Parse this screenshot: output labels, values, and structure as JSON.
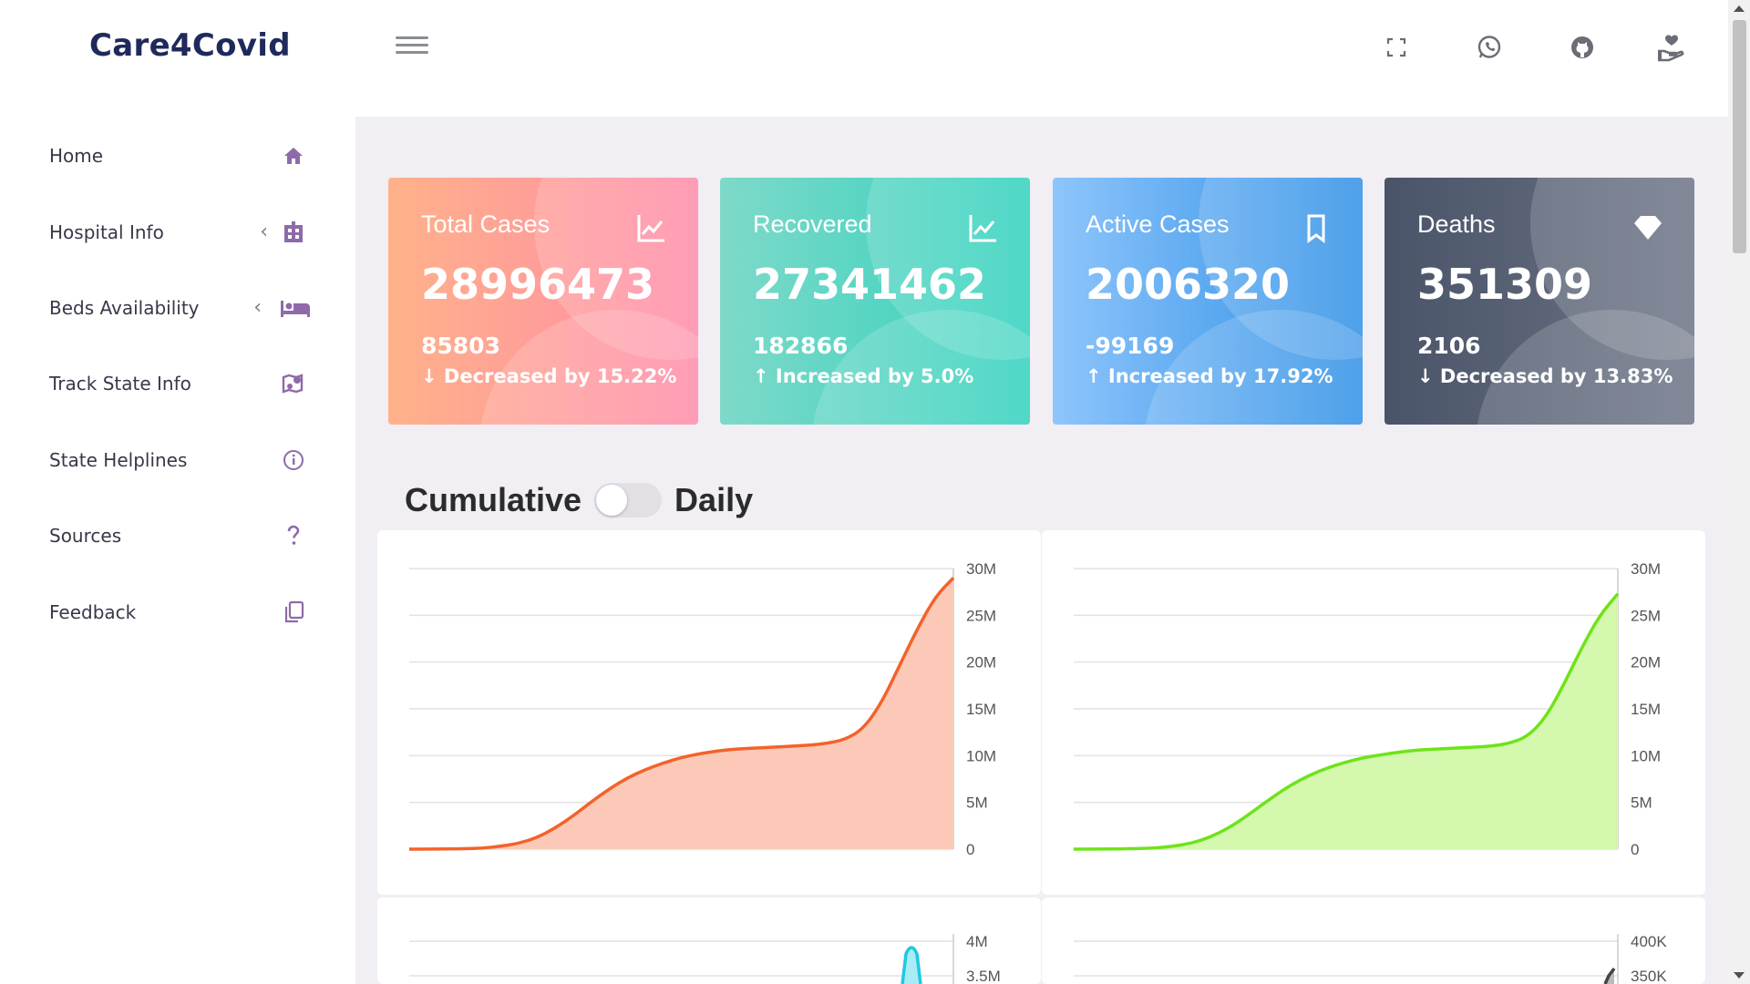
{
  "brand": "Care4Covid",
  "header_icons": [
    "fullscreen-icon",
    "whatsapp-icon",
    "github-icon",
    "donate-icon"
  ],
  "sidebar": {
    "items": [
      {
        "label": "Home",
        "icon": "home-icon",
        "has_arrow": false
      },
      {
        "label": "Hospital Info",
        "icon": "hospital-icon",
        "has_arrow": true
      },
      {
        "label": "Beds Availability",
        "icon": "bed-icon",
        "has_arrow": true
      },
      {
        "label": "Track State Info",
        "icon": "map-pin-icon",
        "has_arrow": false
      },
      {
        "label": "State Helplines",
        "icon": "info-icon",
        "has_arrow": false
      },
      {
        "label": "Sources",
        "icon": "question-icon",
        "has_arrow": false
      },
      {
        "label": "Feedback",
        "icon": "copy-icon",
        "has_arrow": false
      }
    ],
    "arrow": "‹"
  },
  "cards": [
    {
      "title": "Total Cases",
      "value": "28996473",
      "delta": "85803",
      "change": "Decreased by 15.22%",
      "direction": "down",
      "icon": "line-chart-icon",
      "colors": [
        "#ffb28a",
        "#ff8aa8"
      ]
    },
    {
      "title": "Recovered",
      "value": "27341462",
      "delta": "182866",
      "change": "Increased by 5.0%",
      "direction": "up",
      "icon": "line-chart-icon",
      "colors": [
        "#7fd9c9",
        "#2fd1bd"
      ]
    },
    {
      "title": "Active Cases",
      "value": "2006320",
      "delta": "-99169",
      "change": "Increased by 17.92%",
      "direction": "up",
      "icon": "bookmark-icon",
      "colors": [
        "#8ec5fb",
        "#2d8fe6"
      ]
    },
    {
      "title": "Deaths",
      "value": "351309",
      "delta": "2106",
      "change": "Decreased by 13.83%",
      "direction": "down",
      "icon": "diamond-icon",
      "colors": [
        "#4a5468",
        "#6b7385"
      ]
    }
  ],
  "toggle": {
    "left": "Cumulative",
    "right": "Daily",
    "state": "off"
  },
  "chart_data": [
    {
      "type": "area",
      "x": [
        "t0",
        "t1",
        "t2",
        "t3",
        "t4",
        "t5",
        "t6",
        "t7",
        "t8",
        "t9",
        "t10",
        "t11",
        "t12",
        "t13",
        "t14",
        "t15",
        "t16",
        "t17",
        "t18",
        "t19",
        "t20",
        "t21",
        "t22",
        "t23",
        "t24",
        "t25",
        "t26",
        "t27",
        "t28",
        "t29",
        "t30"
      ],
      "values": [
        0,
        0.01,
        0.02,
        0.05,
        0.1,
        0.3,
        0.6,
        1.2,
        2.2,
        3.5,
        5.0,
        6.4,
        7.6,
        8.5,
        9.2,
        9.8,
        10.2,
        10.5,
        10.7,
        10.8,
        10.9,
        11.0,
        11.1,
        11.3,
        11.7,
        12.8,
        15.5,
        19.5,
        23.5,
        27.0,
        29.0
      ],
      "unit": "M",
      "ylim": [
        0,
        30
      ],
      "yticks": [
        "0",
        "5M",
        "10M",
        "15M",
        "20M",
        "25M",
        "30M"
      ],
      "color": "#f4622a",
      "fill": "#fcc9b8"
    },
    {
      "type": "area",
      "x": [
        "t0",
        "t1",
        "t2",
        "t3",
        "t4",
        "t5",
        "t6",
        "t7",
        "t8",
        "t9",
        "t10",
        "t11",
        "t12",
        "t13",
        "t14",
        "t15",
        "t16",
        "t17",
        "t18",
        "t19",
        "t20",
        "t21",
        "t22",
        "t23",
        "t24",
        "t25",
        "t26",
        "t27",
        "t28",
        "t29",
        "t30"
      ],
      "values": [
        0,
        0.01,
        0.02,
        0.04,
        0.08,
        0.2,
        0.45,
        0.9,
        1.7,
        2.8,
        4.2,
        5.6,
        6.9,
        7.9,
        8.7,
        9.3,
        9.8,
        10.1,
        10.4,
        10.6,
        10.7,
        10.8,
        10.9,
        11.0,
        11.3,
        12.0,
        14.0,
        17.5,
        21.5,
        25.0,
        27.3
      ],
      "unit": "M",
      "ylim": [
        0,
        30
      ],
      "yticks": [
        "0",
        "5M",
        "10M",
        "15M",
        "20M",
        "25M",
        "30M"
      ],
      "color": "#6ee31a",
      "fill": "#d4f8ad"
    },
    {
      "type": "area",
      "yticks": [
        "3.5M",
        "4M"
      ],
      "color": "#20c8e0",
      "fill": "#a8ecf5"
    },
    {
      "type": "area",
      "yticks": [
        "350K",
        "400K"
      ],
      "color": "#444444",
      "fill": "#bbbbbb"
    }
  ]
}
